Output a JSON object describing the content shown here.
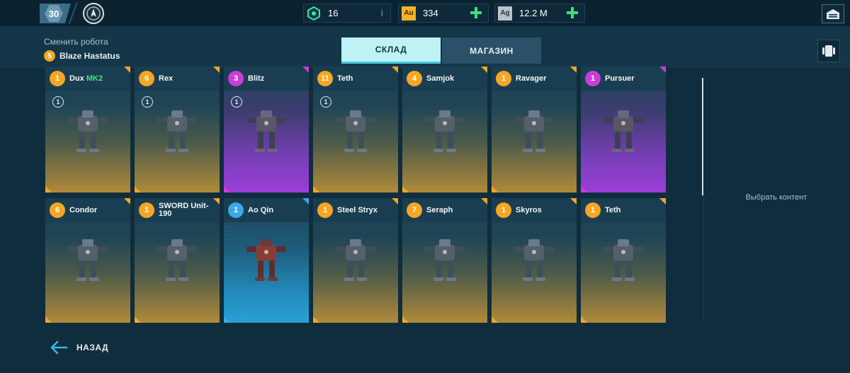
{
  "topbar": {
    "player_level": "30",
    "currencies": [
      {
        "name": "key",
        "icon": "key-hex-icon",
        "value": "16",
        "info": "i",
        "color": "#3fe0b0"
      },
      {
        "name": "gold",
        "icon": "gold-au-icon",
        "code": "Au",
        "value": "334",
        "color": "#f5b324"
      },
      {
        "name": "silver",
        "icon": "silver-ag-icon",
        "code": "Ag",
        "value": "12.2 M",
        "color": "#b9c3c9"
      }
    ]
  },
  "header": {
    "change_robot_label": "Сменить робота",
    "current_robot_level": "5",
    "current_robot_name": "Blaze Hastatus",
    "tabs": [
      {
        "label": "СКЛАД",
        "active": true
      },
      {
        "label": "МАГАЗИН",
        "active": false
      }
    ]
  },
  "robots": [
    {
      "level": "1",
      "name": "Dux",
      "suffix": "MK2",
      "rarity": "gold",
      "slot": "1"
    },
    {
      "level": "6",
      "name": "Rex",
      "rarity": "gold",
      "slot": "1"
    },
    {
      "level": "3",
      "name": "Blitz",
      "rarity": "epic",
      "slot": "1"
    },
    {
      "level": "11",
      "name": "Teth",
      "rarity": "gold",
      "slot": "1"
    },
    {
      "level": "4",
      "name": "Samjok",
      "rarity": "gold"
    },
    {
      "level": "1",
      "name": "Ravager",
      "rarity": "gold"
    },
    {
      "level": "1",
      "name": "Pursuer",
      "rarity": "epic"
    },
    {
      "level": "6",
      "name": "Condor",
      "rarity": "gold"
    },
    {
      "level": "1",
      "name": "SWORD Unit-190",
      "rarity": "gold"
    },
    {
      "level": "1",
      "name": "Ao Qin",
      "rarity": "rare"
    },
    {
      "level": "1",
      "name": "Steel Stryx",
      "rarity": "gold"
    },
    {
      "level": "7",
      "name": "Seraph",
      "rarity": "gold"
    },
    {
      "level": "1",
      "name": "Skyros",
      "rarity": "gold"
    },
    {
      "level": "1",
      "name": "Teth",
      "rarity": "gold"
    }
  ],
  "side_panel": {
    "choose_content": "Выбрать контент"
  },
  "footer": {
    "back_label": "НАЗАД"
  },
  "colors": {
    "gold": "#f5a623",
    "epic": "#c93ddb",
    "rare": "#3aa9e8",
    "accent": "#48c7dc"
  }
}
